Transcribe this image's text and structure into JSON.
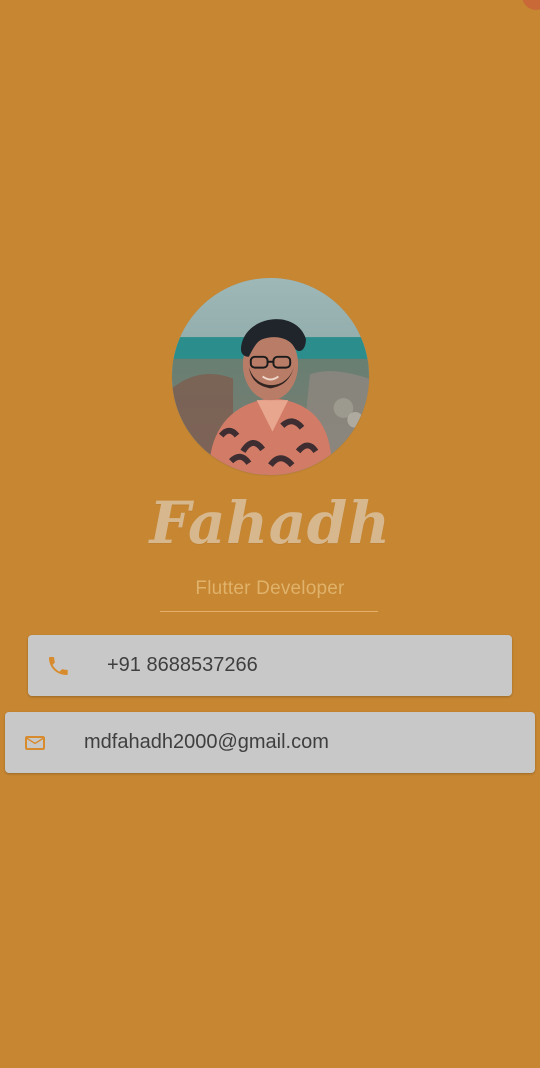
{
  "profile": {
    "name": "Fahadh",
    "title": "Flutter Developer"
  },
  "contacts": {
    "phone": {
      "icon": "phone-icon",
      "value": "+91 8688537266"
    },
    "email": {
      "icon": "email-icon",
      "value": "mdfahadh2000@gmail.com"
    }
  },
  "colors": {
    "background": "#C68632",
    "card": "#C8C8C8",
    "accent": "#D88B2C",
    "name": "#D7B88E",
    "subtitle": "#E0B26A",
    "text": "#3F3F3F"
  }
}
